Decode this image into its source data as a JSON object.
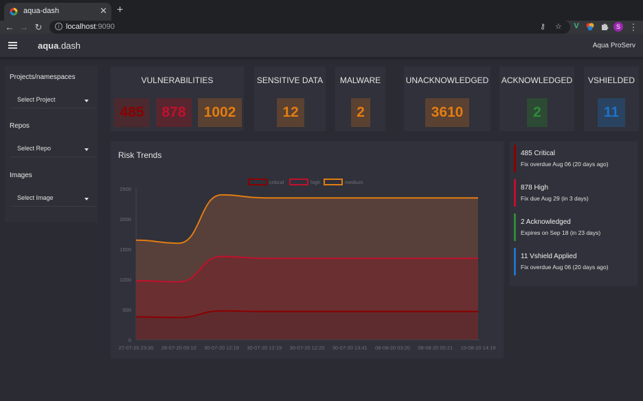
{
  "browser": {
    "tab_title": "aqua-dash",
    "tab_close": "✕",
    "new_tab": "+",
    "url_host": "localhost",
    "url_port": ":9090",
    "profile_initial": "S"
  },
  "app": {
    "brand_bold": "aqua",
    "brand_rest": ".dash",
    "company": "Aqua ProServ"
  },
  "sidebar": {
    "projects_label": "Projects/namespaces",
    "projects_select": "Select Project",
    "repos_label": "Repos",
    "repos_select": "Select Repo",
    "images_label": "Images",
    "images_select": "Select Image"
  },
  "cards": {
    "vulnerabilities": {
      "title": "VULNERABILITIES",
      "critical": "485",
      "high": "878",
      "medium": "1002"
    },
    "sensitive": {
      "title": "SENSITIVE DATA",
      "value": "12"
    },
    "malware": {
      "title": "MALWARE",
      "value": "2"
    },
    "unacknowledged": {
      "title": "UNACKNOWLEDGED",
      "value": "3610"
    },
    "acknowledged": {
      "title": "ACKNOWLEDGED",
      "value": "2"
    },
    "vshielded": {
      "title": "VSHIELDED",
      "value": "11"
    }
  },
  "colors": {
    "critical": "#8b0000",
    "high": "#c2102c",
    "medium": "#e27d12",
    "acknowledged": "#2e8b3a",
    "vshield": "#1f72c8"
  },
  "chart_title": "Risk Trends",
  "chart_data": {
    "type": "area",
    "title": "Risk Trends",
    "categories": [
      "27-07-20 23:30",
      "28-07-20 09:10",
      "30-07-20 12:19",
      "30-07-20 12:19",
      "30-07-20 12:20",
      "30-07-20 13:41",
      "08-08-20 03:20",
      "08-08-20 00:21",
      "10-08-20 14:19"
    ],
    "series": [
      {
        "name": "critical",
        "values": [
          380,
          370,
          480,
          470,
          470,
          470,
          470,
          470,
          470
        ]
      },
      {
        "name": "high",
        "values": [
          980,
          960,
          1380,
          1350,
          1350,
          1350,
          1350,
          1350,
          1350
        ]
      },
      {
        "name": "medium",
        "values": [
          1650,
          1600,
          2400,
          2350,
          2350,
          2350,
          2350,
          2350,
          2350
        ]
      }
    ],
    "ylim": [
      0,
      2500
    ],
    "yticks": [
      0,
      500,
      1000,
      1500,
      2000,
      2500
    ],
    "legend": "top-center",
    "grid": false
  },
  "alerts": [
    {
      "title": "485 Critical",
      "sub": "Fix overdue Aug 06 (20 days ago)",
      "color": "#8b0000"
    },
    {
      "title": "878 High",
      "sub": "Fix due Aug 29 (in 3 days)",
      "color": "#c2102c"
    },
    {
      "title": "2 Acknowledged",
      "sub": "Expires on Sep 18 (in 23 days)",
      "color": "#2e8b3a"
    },
    {
      "title": "11 Vshield Applied",
      "sub": "Fix overdue Aug 06 (20 days ago)",
      "color": "#1f72c8"
    }
  ]
}
